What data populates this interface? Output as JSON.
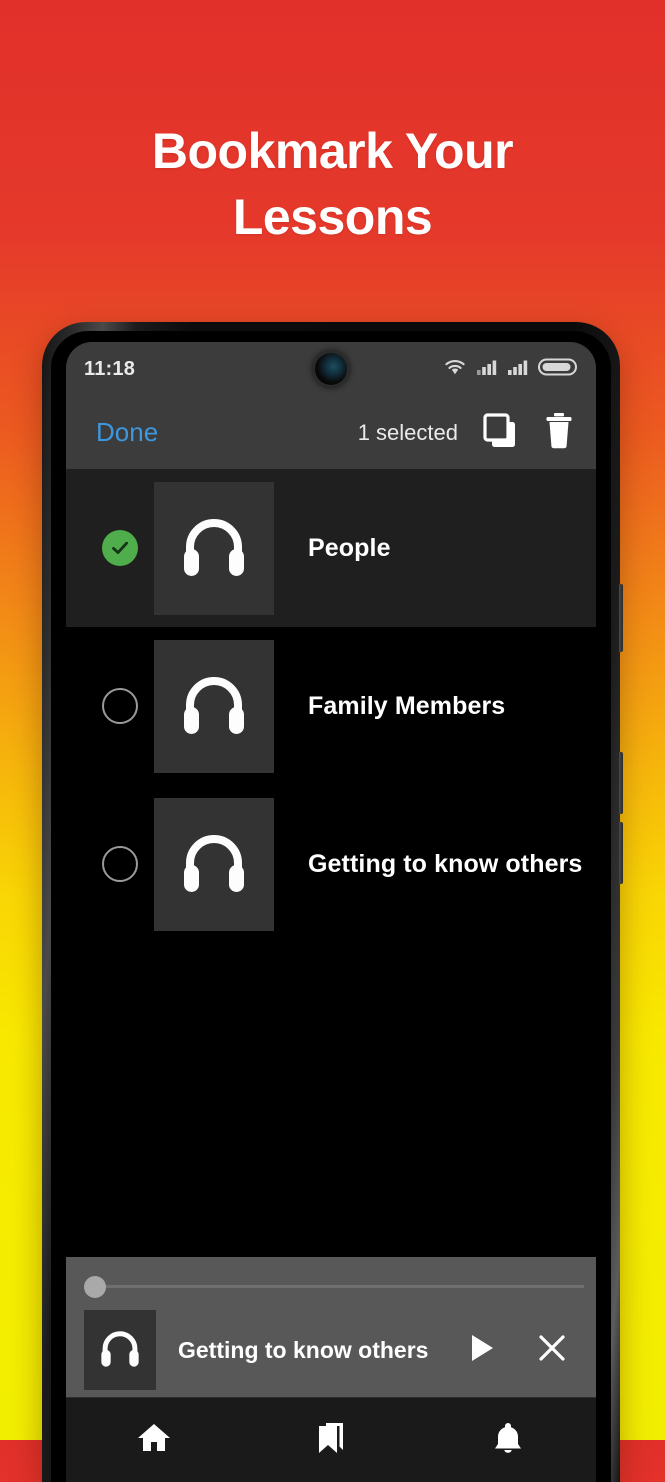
{
  "promo": {
    "headline_line1": "Bookmark Your",
    "headline_line2": "Lessons",
    "background_top_color": "#e1302a",
    "background_bottom_color": "#f2ee00"
  },
  "status_bar": {
    "time": "11:18",
    "icons": [
      "wifi-icon",
      "signal-icon",
      "signal-icon",
      "battery-icon"
    ]
  },
  "toolbar": {
    "done_label": "Done",
    "selected_label": "1 selected",
    "copy_icon": "copy-icon",
    "delete_icon": "trash-icon",
    "done_color": "#3d97de"
  },
  "list": {
    "items": [
      {
        "title": "People",
        "selected": true,
        "thumb_icon": "headphones-icon"
      },
      {
        "title": "Family Members",
        "selected": false,
        "thumb_icon": "headphones-icon"
      },
      {
        "title": "Getting to know others",
        "selected": false,
        "thumb_icon": "headphones-icon"
      }
    ],
    "selected_check_color": "#4fae4b"
  },
  "player": {
    "title": "Getting to know others",
    "thumb_icon": "headphones-icon",
    "play_icon": "play-icon",
    "close_icon": "close-icon",
    "progress_percent": 0
  },
  "bottom_nav": {
    "items": [
      {
        "icon": "home-icon",
        "active": false
      },
      {
        "icon": "bookmark-icon",
        "active": true
      },
      {
        "icon": "bell-icon",
        "active": false
      }
    ]
  }
}
